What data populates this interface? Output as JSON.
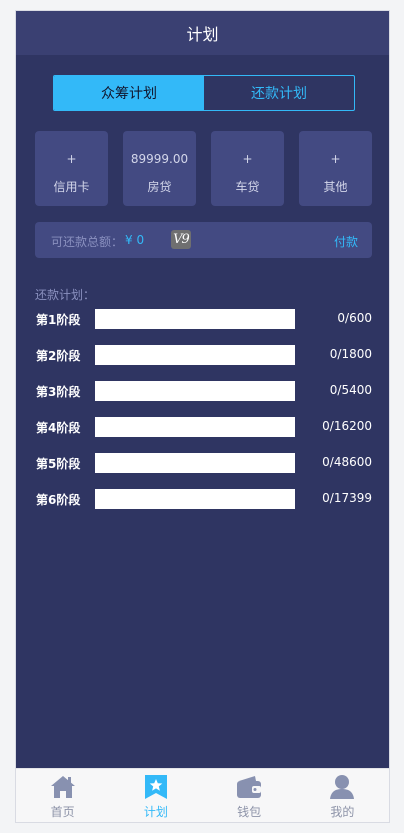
{
  "header": {
    "title": "计划"
  },
  "segment": {
    "tabs": [
      {
        "label": "众筹计划",
        "active": true
      },
      {
        "label": "还款计划",
        "active": false
      }
    ]
  },
  "cards": [
    {
      "top": "+",
      "label": "信用卡"
    },
    {
      "top": "89999.00",
      "label": "房贷"
    },
    {
      "top": "+",
      "label": "车贷"
    },
    {
      "top": "+",
      "label": "其他"
    }
  ],
  "paybar": {
    "label": "可还款总额：",
    "amount": "¥ 0",
    "vip": "V9",
    "action": "付款"
  },
  "plan": {
    "title": "还款计划：",
    "stages": [
      {
        "name": "第1阶段",
        "progress": 0,
        "value": "0/600"
      },
      {
        "name": "第2阶段",
        "progress": 0,
        "value": "0/1800"
      },
      {
        "name": "第3阶段",
        "progress": 0,
        "value": "0/5400"
      },
      {
        "name": "第4阶段",
        "progress": 0,
        "value": "0/16200"
      },
      {
        "name": "第5阶段",
        "progress": 0,
        "value": "0/48600"
      },
      {
        "name": "第6阶段",
        "progress": 0,
        "value": "0/17399"
      }
    ]
  },
  "tabbar": {
    "items": [
      {
        "label": "首页",
        "icon": "home-icon",
        "active": false
      },
      {
        "label": "计划",
        "icon": "plan-star-icon",
        "active": true
      },
      {
        "label": "钱包",
        "icon": "wallet-icon",
        "active": false
      },
      {
        "label": "我的",
        "icon": "profile-icon",
        "active": false
      }
    ]
  },
  "colors": {
    "accent": "#33b9f8",
    "background": "#2f3562",
    "card": "#434a82"
  }
}
